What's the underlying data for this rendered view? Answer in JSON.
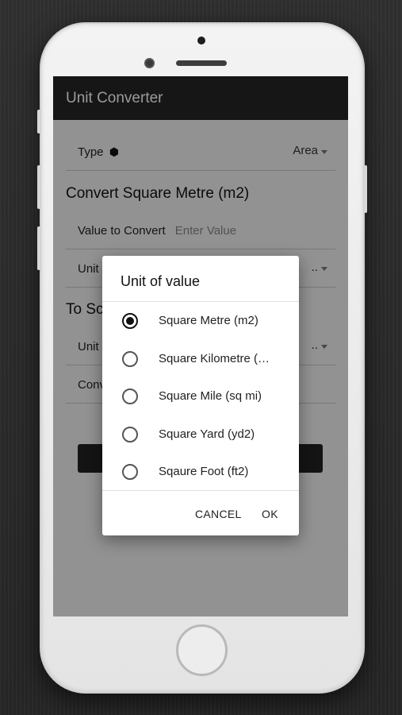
{
  "app": {
    "title": "Unit Converter"
  },
  "form": {
    "type_label": "Type",
    "type_icon": "cube-icon",
    "type_value": "Area",
    "convert_heading": "Convert Square Metre (m2)",
    "value_label": "Value to Convert",
    "value_placeholder": "Enter Value",
    "unit_label": "Unit",
    "unit_value_partial": "..",
    "to_heading": "To Sc",
    "unit2_label": "Unit",
    "unit2_value_partial": "..",
    "converted_label": "Conv"
  },
  "dialog": {
    "title": "Unit of value",
    "options": [
      {
        "label": "Square Metre (m2)",
        "checked": true
      },
      {
        "label": "Square Kilometre (…",
        "checked": false
      },
      {
        "label": "Square Mile (sq mi)",
        "checked": false
      },
      {
        "label": "Square Yard (yd2)",
        "checked": false
      },
      {
        "label": "Sqaure Foot (ft2)",
        "checked": false
      }
    ],
    "cancel_label": "CANCEL",
    "ok_label": "OK"
  },
  "colors": {
    "appbar": "#262626",
    "screen_background": "#f4f4f4",
    "dialog_background": "#ffffff",
    "scrim": "rgba(0,0,0,0.4)"
  }
}
